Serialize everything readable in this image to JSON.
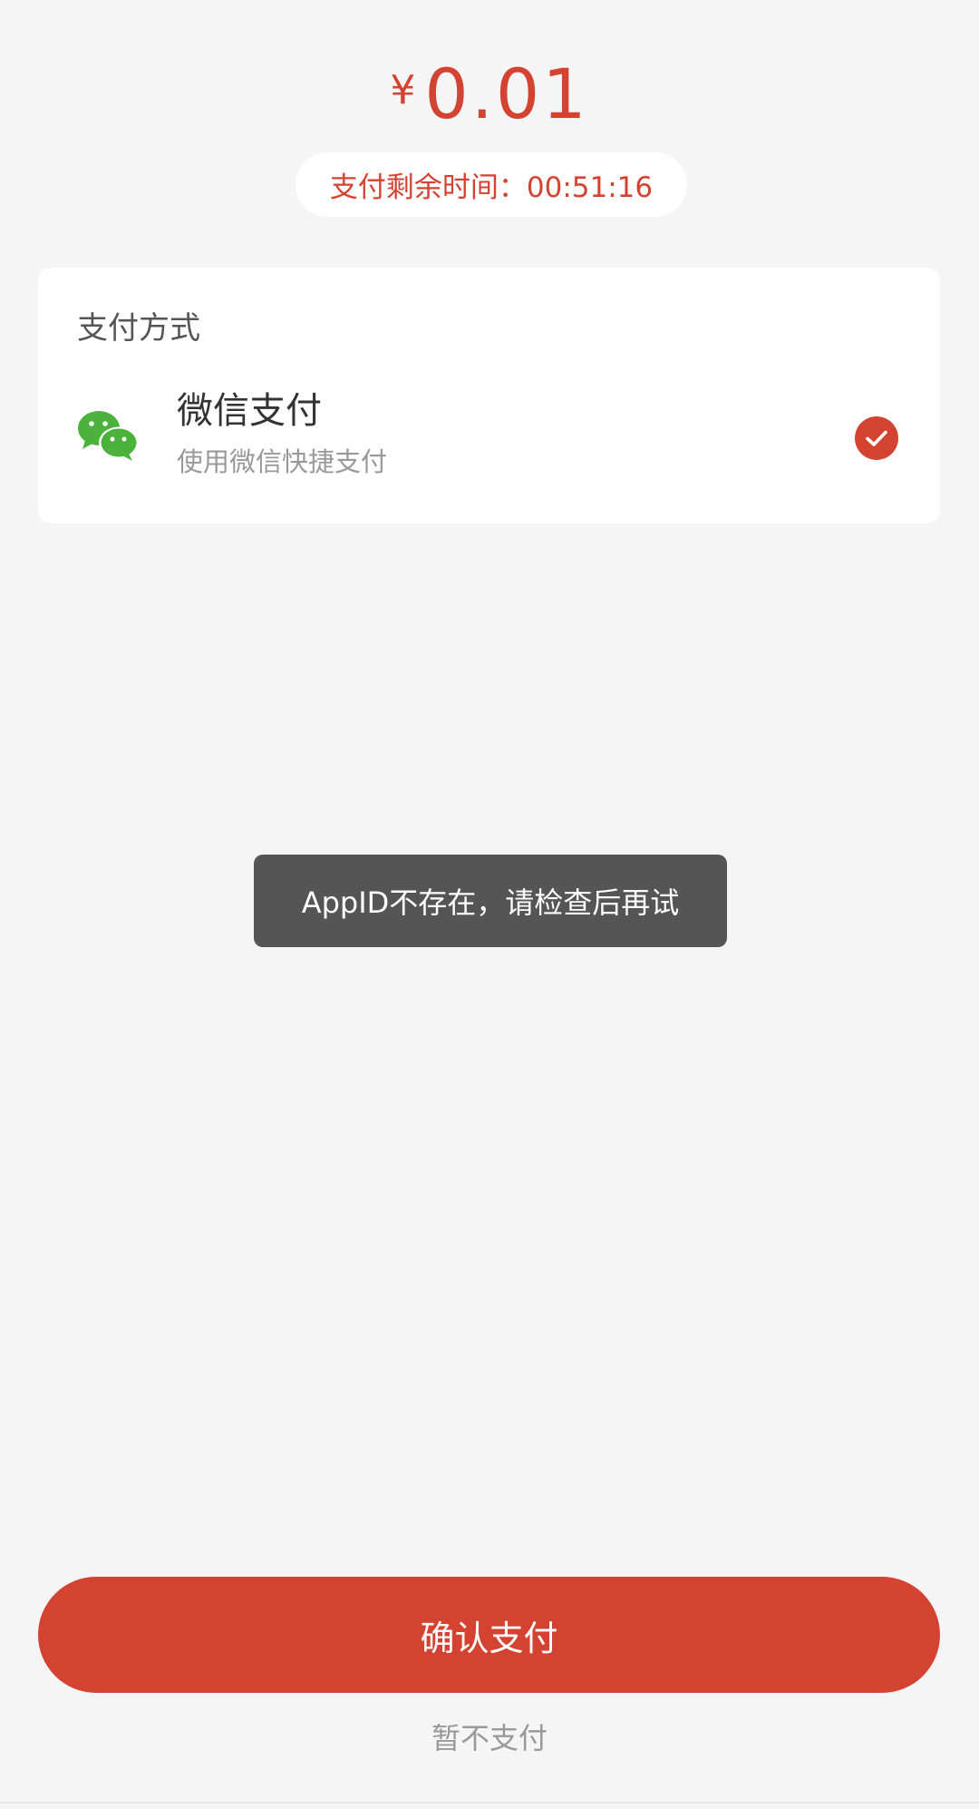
{
  "amount": {
    "currency_symbol": "¥",
    "value": "0.01"
  },
  "timer": {
    "text": "支付剩余时间：00:51:16"
  },
  "payment_section": {
    "title": "支付方式",
    "methods": [
      {
        "icon": "wechat-icon",
        "name": "微信支付",
        "description": "使用微信快捷支付",
        "selected": true
      }
    ]
  },
  "toast": {
    "message": "AppID不存在，请检查后再试"
  },
  "actions": {
    "confirm_label": "确认支付",
    "skip_label": "暂不支付"
  },
  "colors": {
    "accent": "#d44332",
    "background": "#f5f5f5",
    "wechat_green": "#4bb33c",
    "toast_background": "#555555"
  }
}
